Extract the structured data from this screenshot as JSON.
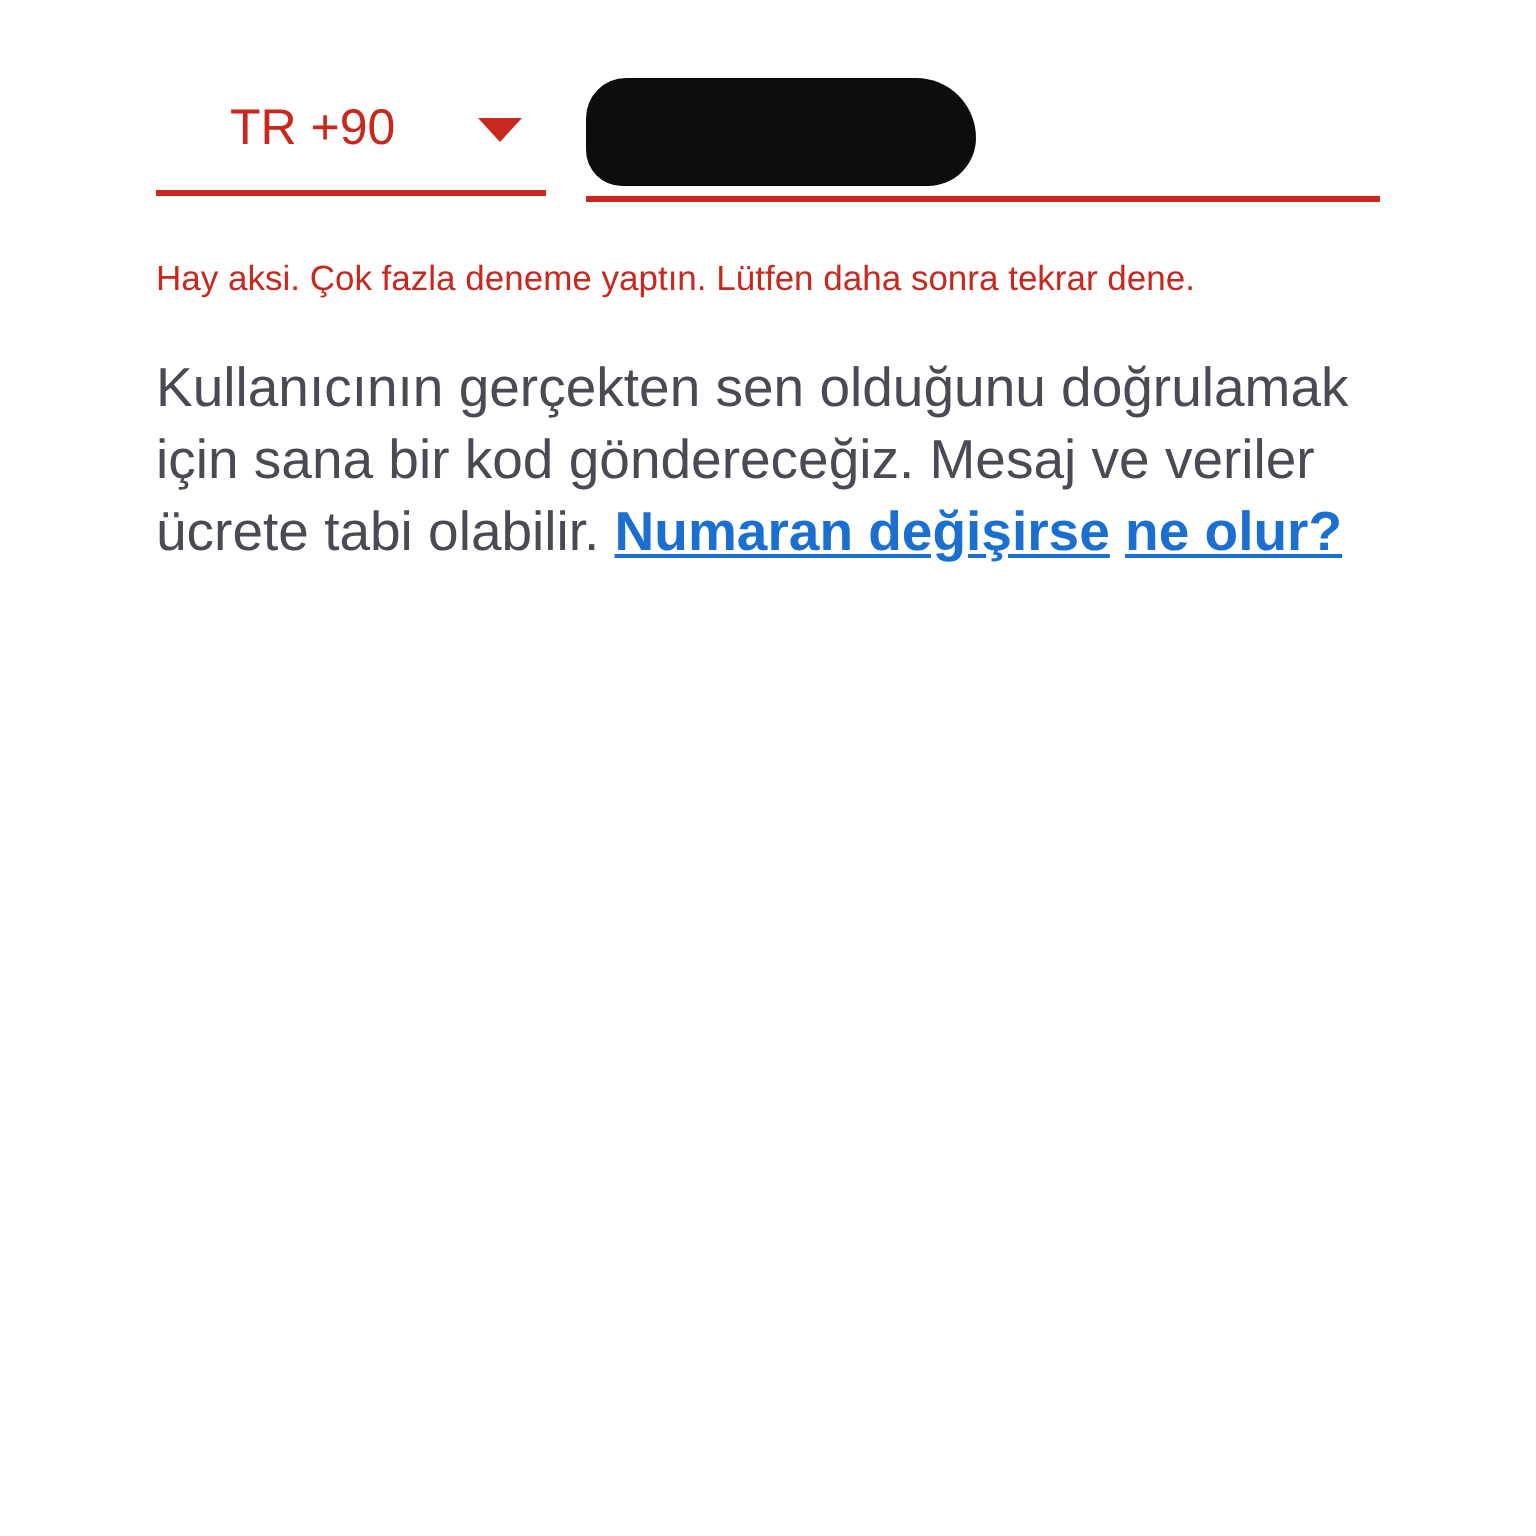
{
  "phone_form": {
    "country_code": "TR +90",
    "phone_redacted": true,
    "error": "Hay aksi. Çok fazla deneme yaptın. Lütfen daha sonra tekrar dene.",
    "info_text": "Kullanıcının gerçekten sen olduğunu doğrulamak için sana bir kod göndereceğiz. Mesaj ve veriler ücrete tabi olabilir.",
    "info_link": "Numaran değişirse ne olur?"
  }
}
